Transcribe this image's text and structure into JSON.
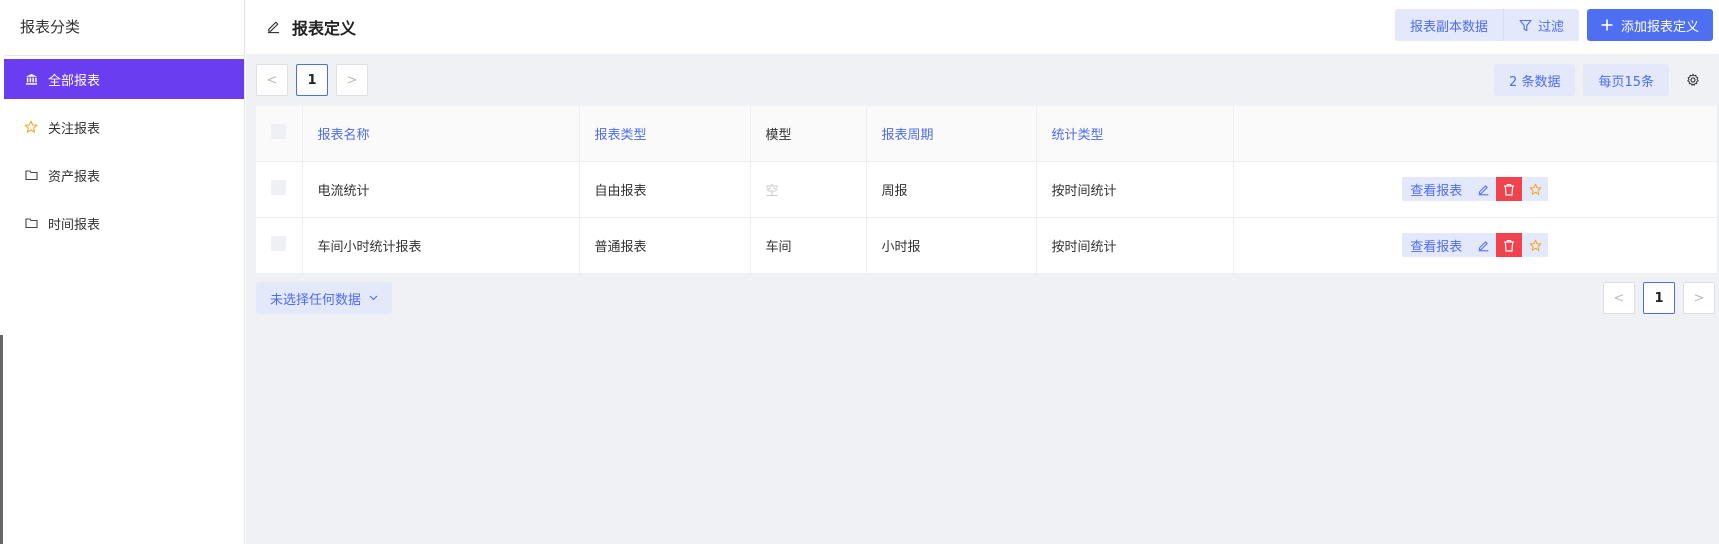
{
  "sidebar": {
    "title": "报表分类",
    "items": [
      {
        "label": "全部报表",
        "icon": "bank-icon",
        "active": true
      },
      {
        "label": "关注报表",
        "icon": "star-icon",
        "active": false
      },
      {
        "label": "资产报表",
        "icon": "folder-icon",
        "active": false
      },
      {
        "label": "时间报表",
        "icon": "folder-icon",
        "active": false
      }
    ]
  },
  "header": {
    "title": "报表定义",
    "actions": {
      "copy_label": "报表副本数据",
      "filter_label": "过滤",
      "add_label": "添加报表定义"
    }
  },
  "toolbar": {
    "pager": {
      "prev": "<",
      "current": "1",
      "next": ">"
    },
    "count_label": "2 条数据",
    "per_page_label": "每页15条"
  },
  "table": {
    "columns": [
      "报表名称",
      "报表类型",
      "模型",
      "报表周期",
      "统计类型",
      ""
    ],
    "rows": [
      {
        "name": "电流统计",
        "type": "自由报表",
        "model": "空",
        "period": "周报",
        "stat": "按时间统计"
      },
      {
        "name": "车间小时统计报表",
        "type": "普通报表",
        "model": "车间",
        "period": "小时报",
        "stat": "按时间统计"
      }
    ],
    "row_action_view": "查看报表"
  },
  "footer": {
    "selection_label": "未选择任何数据",
    "pager": {
      "prev": "<",
      "current": "1",
      "next": ">"
    }
  },
  "colors": {
    "accent": "#4f6ff2",
    "active_sidebar": "#6a3df0",
    "danger": "#f0434e",
    "star": "#f5a623"
  }
}
